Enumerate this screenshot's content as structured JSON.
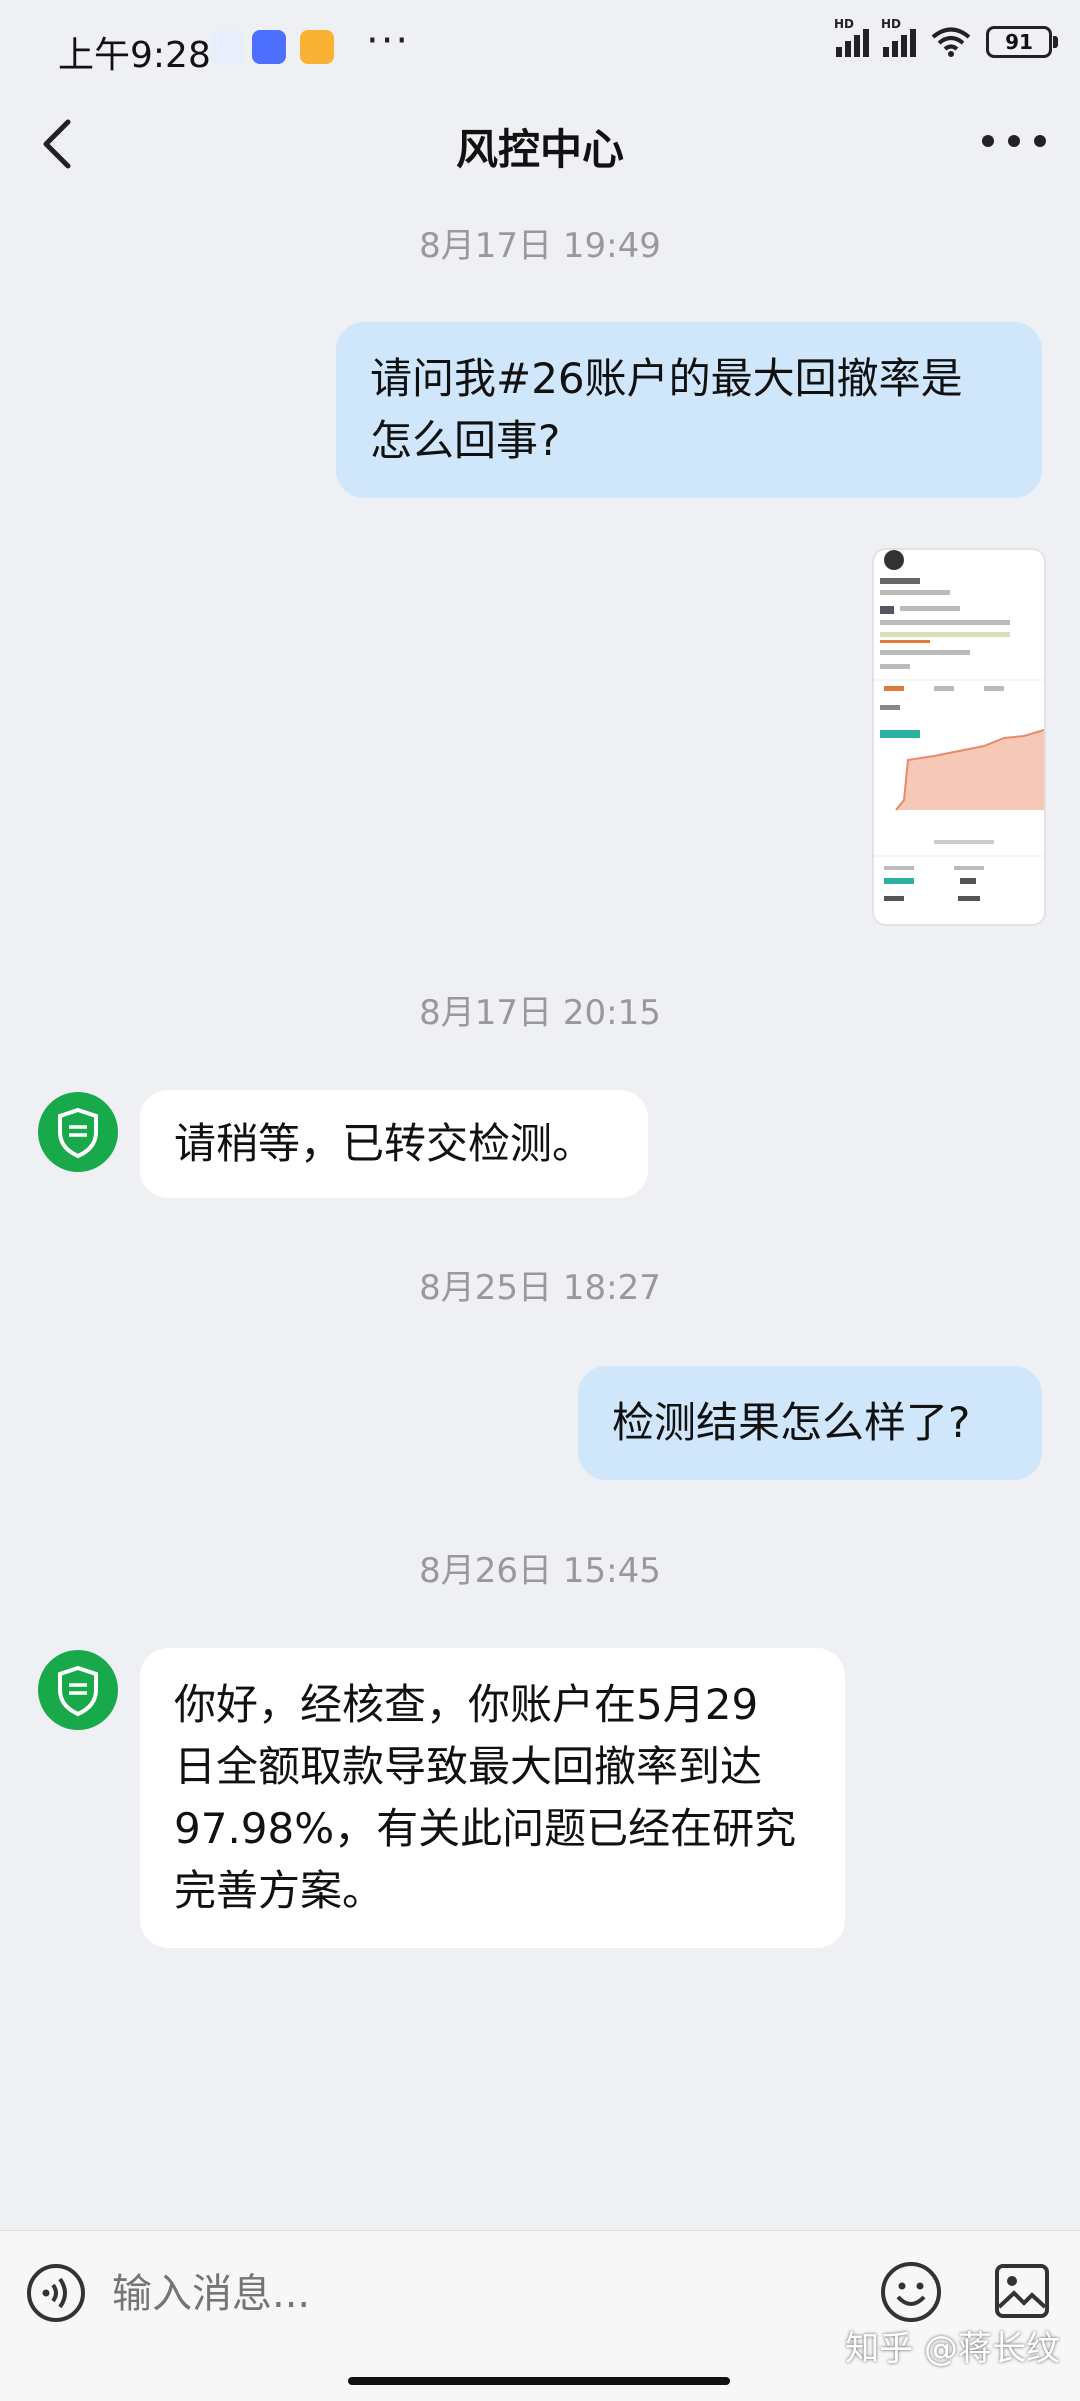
{
  "status_bar": {
    "time": "上午9:28",
    "more": "···",
    "battery": "91",
    "signal_hd": "HD"
  },
  "header": {
    "title": "风控中心"
  },
  "chat": {
    "timestamps": [
      "8月17日 19:49",
      "8月17日 20:15",
      "8月25日 18:27",
      "8月26日 15:45"
    ],
    "messages": [
      {
        "from": "user",
        "text_lines": [
          "请问我#26账户的最大回撤率是",
          "怎么回事?"
        ]
      },
      {
        "from": "support",
        "text_lines": [
          "请稍等，已转交检测。"
        ]
      },
      {
        "from": "user",
        "text_lines": [
          "检测结果怎么样了?"
        ]
      },
      {
        "from": "support",
        "text_lines": [
          "你好，经核查，你账户在5月29",
          "日全额取款导致最大回撤率到达",
          "97.98%，有关此问题已经在研究",
          "完善方案。"
        ]
      }
    ]
  },
  "input": {
    "placeholder": "输入消息..."
  },
  "watermark": "知乎 @蒋长纹",
  "colors": {
    "accent": "#18a94a",
    "user_bubble": "#cfe6fb",
    "support_bubble": "#ffffff",
    "background": "#eef0f3"
  }
}
